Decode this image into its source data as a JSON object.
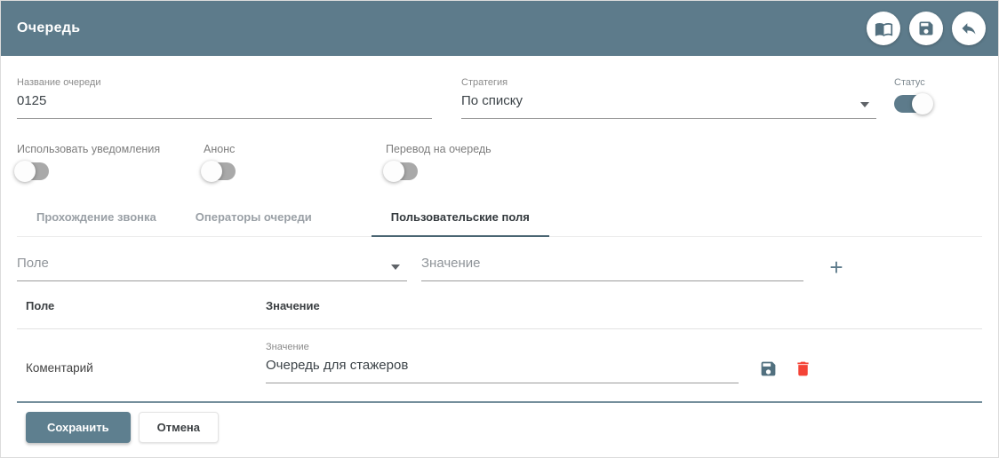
{
  "header": {
    "title": "Очередь",
    "buttons": [
      {
        "icon": "open-book-icon"
      },
      {
        "icon": "save-icon"
      },
      {
        "icon": "undo-icon"
      }
    ]
  },
  "form": {
    "queue_name": {
      "label": "Название очереди",
      "value": "0125"
    },
    "strategy": {
      "label": "Стратегия",
      "value": "По списку"
    },
    "status": {
      "label": "Статус",
      "on": true
    },
    "toggles": [
      {
        "label": "Использовать уведомления",
        "on": false
      },
      {
        "label": "Анонс",
        "on": false
      },
      {
        "label": "Перевод на очередь",
        "on": false
      }
    ]
  },
  "tabs": [
    {
      "label": "Прохождение звонка",
      "active": false
    },
    {
      "label": "Операторы очереди",
      "active": false
    },
    {
      "label": "Пользовательские поля",
      "active": true
    }
  ],
  "custom_fields": {
    "field_select_placeholder": "Поле",
    "value_input_placeholder": "Значение",
    "add_button_label": "+",
    "table": {
      "headers": [
        "Поле",
        "Значение"
      ],
      "rows": [
        {
          "field": "Коментарий",
          "value_label": "Значение",
          "value": "Очередь для стажеров"
        }
      ]
    }
  },
  "actions": {
    "save_label": "Сохранить",
    "cancel_label": "Отмена"
  },
  "colors": {
    "accent": "#5d7b8b",
    "tab_indicator": "#4a6572",
    "danger": "#f44336",
    "row_icon": "#51707f"
  }
}
